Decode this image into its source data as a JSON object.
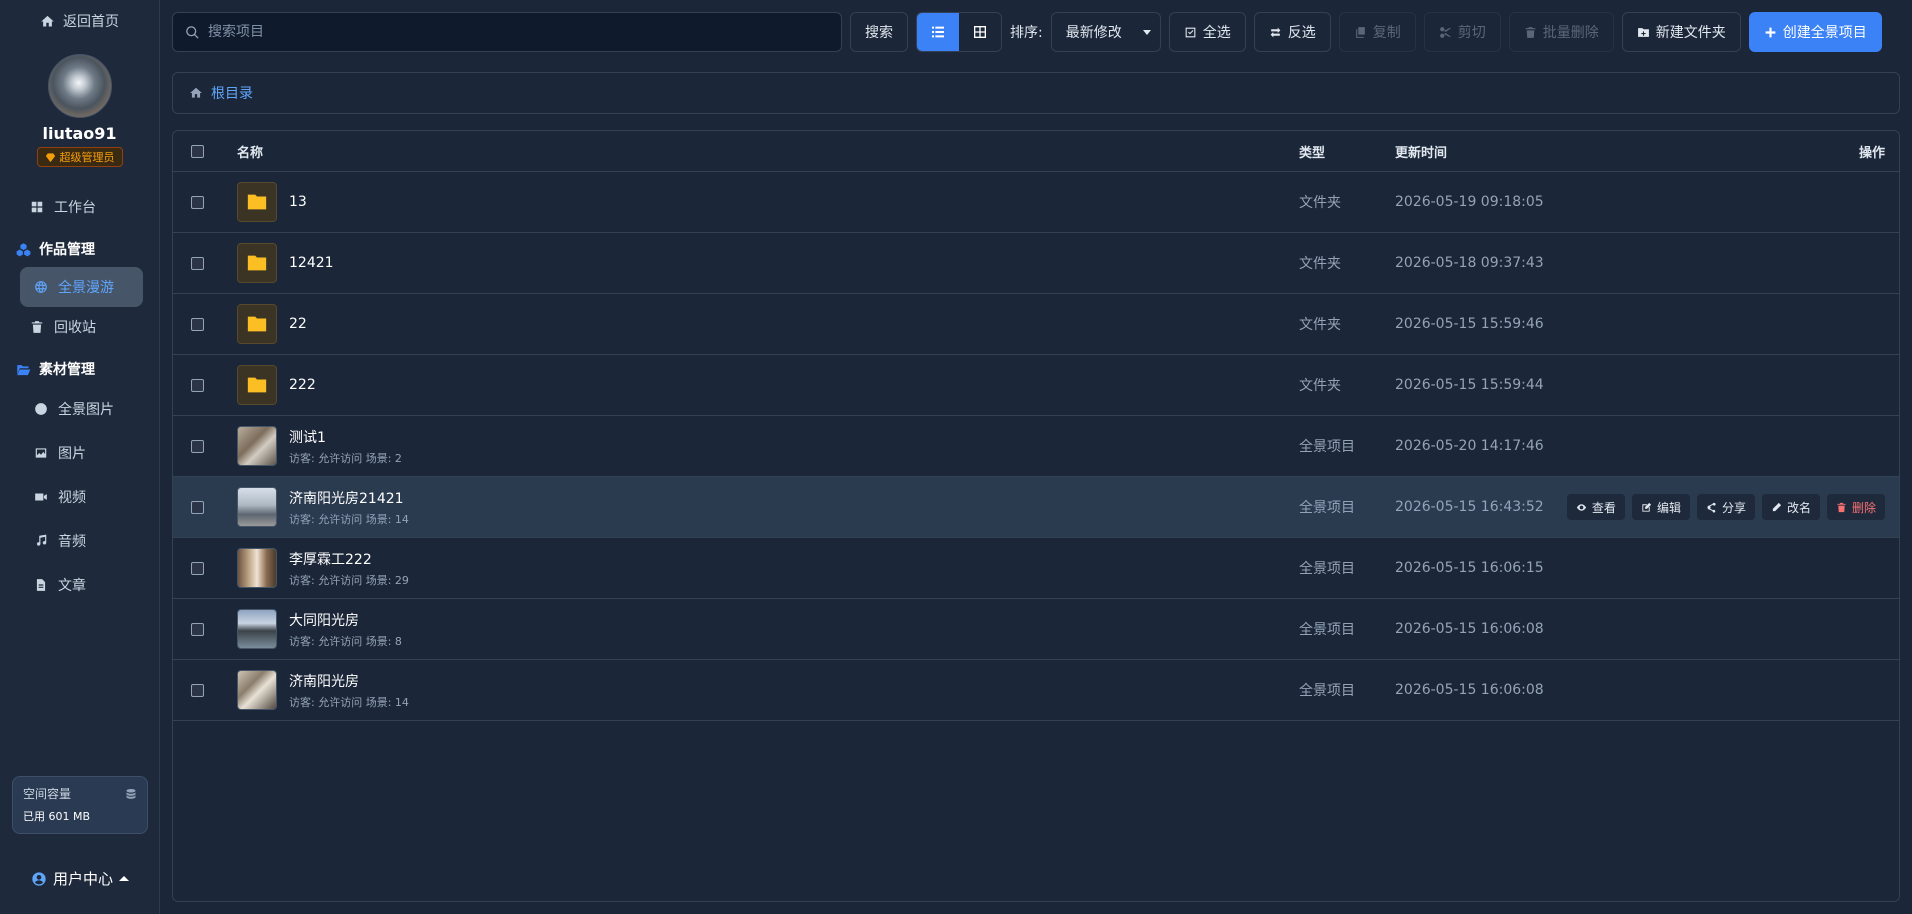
{
  "sidebar": {
    "back_label": "返回首页",
    "username": "liutao91",
    "role": "超级管理员",
    "workbench": "工作台",
    "group_works": "作品管理",
    "panorama_tour": "全景漫游",
    "recycle": "回收站",
    "group_assets": "素材管理",
    "panorama_images": "全景图片",
    "images": "图片",
    "videos": "视频",
    "audio": "音频",
    "articles": "文章",
    "storage_title": "空间容量",
    "storage_used": "已用 601 MB",
    "user_center": "用户中心"
  },
  "toolbar": {
    "search_placeholder": "搜索项目",
    "search_btn": "搜索",
    "sort_label": "排序:",
    "sort_value": "最新修改",
    "select_all": "全选",
    "invert": "反选",
    "copy": "复制",
    "cut": "剪切",
    "batch_delete": "批量删除",
    "new_folder": "新建文件夹",
    "create_project": "创建全景项目"
  },
  "breadcrumb": {
    "root": "根目录"
  },
  "table": {
    "headers": {
      "name": "名称",
      "type": "类型",
      "time": "更新时间",
      "ops": "操作"
    },
    "folders": [
      {
        "name": "13",
        "type": "文件夹",
        "time": "2026-05-19 09:18:05"
      },
      {
        "name": "12421",
        "type": "文件夹",
        "time": "2026-05-18 09:37:43"
      },
      {
        "name": "22",
        "type": "文件夹",
        "time": "2026-05-15 15:59:46"
      },
      {
        "name": "222",
        "type": "文件夹",
        "time": "2026-05-15 15:59:44"
      }
    ],
    "projects": [
      {
        "name": "测试1",
        "meta": "访客: 允许访问  场景: 2",
        "type": "全景项目",
        "time": "2026-05-20 14:17:46"
      },
      {
        "name": "济南阳光房21421",
        "meta": "访客: 允许访问  场景: 14",
        "type": "全景项目",
        "time": "2026-05-15 16:43:52"
      },
      {
        "name": "李厚霖工222",
        "meta": "访客: 允许访问  场景: 29",
        "type": "全景项目",
        "time": "2026-05-15 16:06:15"
      },
      {
        "name": "大同阳光房",
        "meta": "访客: 允许访问  场景: 8",
        "type": "全景项目",
        "time": "2026-05-15 16:06:08"
      },
      {
        "name": "济南阳光房",
        "meta": "访客: 允许访问  场景: 14",
        "type": "全景项目",
        "time": "2026-05-15 16:06:08"
      }
    ],
    "row_actions": {
      "view": "查看",
      "edit": "编辑",
      "share": "分享",
      "rename": "改名",
      "delete": "删除"
    }
  },
  "colors": {
    "accent": "#3b82f6",
    "folder": "#fbbf24",
    "danger": "#f87171",
    "badge": "#f59e0b"
  }
}
